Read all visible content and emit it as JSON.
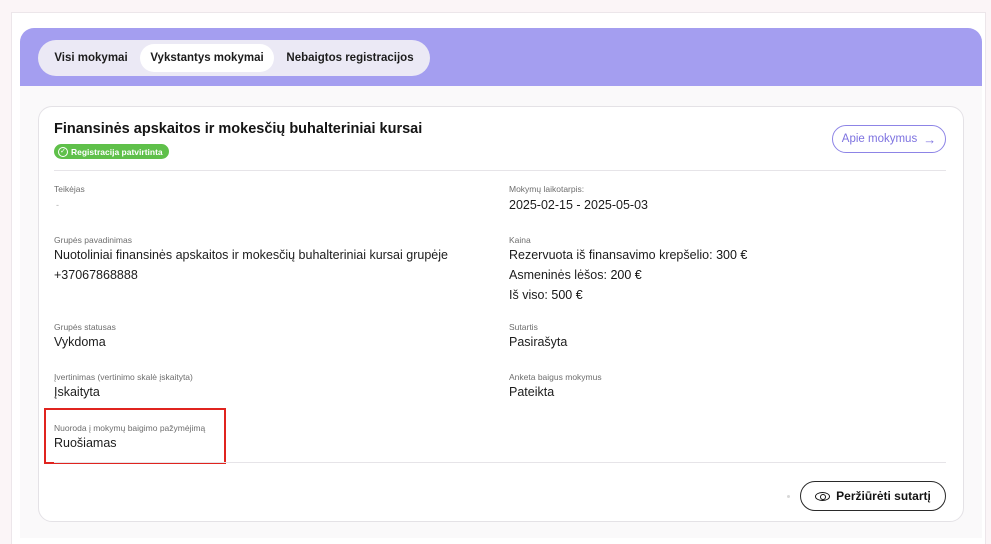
{
  "tabs": [
    {
      "label": "Visi mokymai",
      "active": false
    },
    {
      "label": "Vykstantys mokymai",
      "active": true
    },
    {
      "label": "Nebaigtos registracijos",
      "active": false
    }
  ],
  "colors": {
    "header_band": "#a49ef0",
    "badge": "#5fc04a",
    "accent": "#7d72e0",
    "highlight": "#e0241f"
  },
  "course": {
    "title": "Finansinės apskaitos ir mokesčių buhalteriniai kursai",
    "status_badge": "Registracija patvirtinta",
    "about_button": "Apie mokymus",
    "about_icon": "arrow-right-icon"
  },
  "fields": {
    "provider": {
      "label": "Teikėjas",
      "value": "-"
    },
    "period": {
      "label": "Mokymų laikotarpis:",
      "value": "2025-02-15 - 2025-05-03"
    },
    "group_name": {
      "label": "Grupės pavadinimas",
      "value_line1": "Nuotoliniai finansinės apskaitos ir mokesčių buhalteriniai kursai grupėje",
      "value_line2": "+37067868888"
    },
    "price": {
      "label": "Kaina",
      "reserved_label": "Rezervuota iš finansavimo krepšelio:",
      "reserved_value": "300 €",
      "own_label": "Asmeninės lėšos:",
      "own_value": "200 €",
      "total_label": "Iš viso:",
      "total_value": "500 €"
    },
    "group_status": {
      "label": "Grupės statusas",
      "value": "Vykdoma"
    },
    "contract": {
      "label": "Sutartis",
      "value": "Pasirašyta"
    },
    "evaluation": {
      "label": "Įvertinimas (vertinimo skalė įskaityta)",
      "value": "Įskaityta"
    },
    "survey": {
      "label": "Anketa baigus mokymus",
      "value": "Pateikta"
    },
    "certificate": {
      "label": "Nuoroda į mokymų baigimo pažymėjimą",
      "value": "Ruošiamas"
    }
  },
  "footer": {
    "view_contract_button": "Peržiūrėti sutartį",
    "view_icon": "eye-icon"
  }
}
